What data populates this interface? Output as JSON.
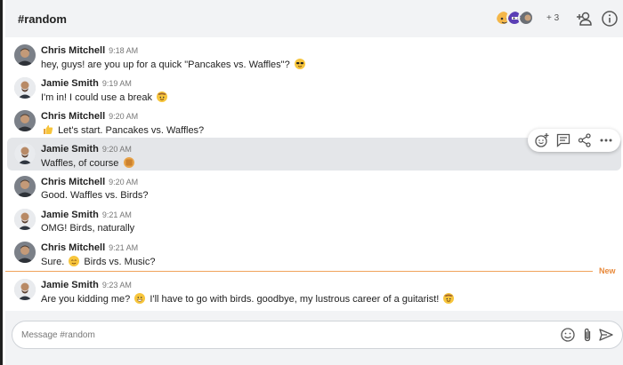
{
  "header": {
    "channel": "#random",
    "more_members": "+ 3",
    "add_member_icon": "add-person-icon",
    "info_icon": "info-icon"
  },
  "messages": [
    {
      "author": "Chris Mitchell",
      "time": "9:18 AM",
      "pre": "hey, guys! are you up for a quick \"Pancakes vs. Waffles\"?",
      "post": "",
      "emoji": "sunglasses-emoji",
      "avatar": "chris"
    },
    {
      "author": "Jamie Smith",
      "time": "9:19 AM",
      "pre": "I'm in! I could use a break",
      "post": "",
      "emoji": "cowboy-emoji",
      "avatar": "jamie"
    },
    {
      "author": "Chris Mitchell",
      "time": "9:20 AM",
      "pre": "",
      "post": "Let's start. Pancakes vs. Waffles?",
      "emoji": "thumbs-up-emoji",
      "avatar": "chris"
    },
    {
      "author": "Jamie Smith",
      "time": "9:20 AM",
      "pre": "Waffles, of course",
      "post": "",
      "emoji": "waffle-emoji",
      "avatar": "jamie"
    },
    {
      "author": "Chris Mitchell",
      "time": "9:20 AM",
      "pre": "Good. Waffles vs. Birds?",
      "post": "",
      "emoji": "",
      "avatar": "chris"
    },
    {
      "author": "Jamie Smith",
      "time": "9:21 AM",
      "pre": "OMG! Birds, naturally",
      "post": "",
      "emoji": "",
      "avatar": "jamie"
    },
    {
      "author": "Chris Mitchell",
      "time": "9:21 AM",
      "pre": "Sure.",
      "post": "Birds vs. Music?",
      "emoji": "smile-emoji",
      "avatar": "chris"
    },
    {
      "author": "Jamie Smith",
      "time": "9:23 AM",
      "pre": "Are you kidding me?",
      "post": "I'll have to go with birds. goodbye, my lustrous career of a guitarist!",
      "emoji": "grin-emoji",
      "emoji2": "cowboy-emoji",
      "avatar": "jamie"
    }
  ],
  "toolbar": {
    "icons": [
      "add-reaction-icon",
      "reply-icon",
      "share-icon",
      "more-icon"
    ]
  },
  "divider": {
    "label": "New"
  },
  "composer": {
    "placeholder": "Message #random",
    "icons": [
      "emoji-icon",
      "attach-icon",
      "send-icon"
    ]
  },
  "colors": {
    "header_bg": "#f2f3f5",
    "highlight_bg": "#e4e6e9",
    "new_divider": "#f0a35a",
    "new_label": "#e8893a"
  }
}
